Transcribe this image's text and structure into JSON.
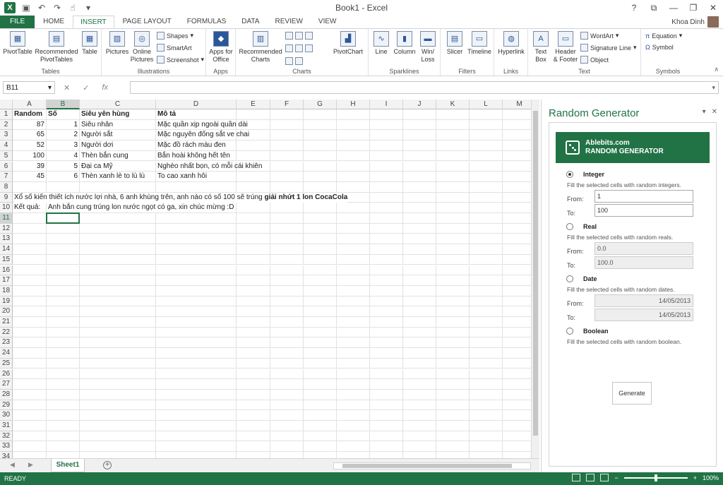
{
  "window": {
    "title": "Book1 - Excel",
    "user": "Khoa Dinh"
  },
  "tabs": [
    "FILE",
    "HOME",
    "INSERT",
    "PAGE LAYOUT",
    "FORMULAS",
    "DATA",
    "REVIEW",
    "VIEW"
  ],
  "active_tab": "INSERT",
  "ribbon": {
    "tables": {
      "label": "Tables",
      "pivottable": "PivotTable",
      "recommended": "Recommended PivotTables",
      "table": "Table"
    },
    "illustrations": {
      "label": "Illustrations",
      "pictures": "Pictures",
      "online": "Online Pictures",
      "shapes": "Shapes",
      "smartart": "SmartArt",
      "screenshot": "Screenshot"
    },
    "apps": {
      "label": "Apps",
      "apps_office": "Apps for Office"
    },
    "charts": {
      "label": "Charts",
      "recommended": "Recommended Charts",
      "pivotchart": "PivotChart"
    },
    "sparklines": {
      "label": "Sparklines",
      "line": "Line",
      "column": "Column",
      "winloss": "Win/ Loss"
    },
    "filters": {
      "label": "Filters",
      "slicer": "Slicer",
      "timeline": "Timeline"
    },
    "links": {
      "label": "Links",
      "hyperlink": "Hyperlink"
    },
    "text": {
      "label": "Text",
      "textbox": "Text Box",
      "headerfooter": "Header & Footer",
      "wordart": "WordArt",
      "signature": "Signature Line",
      "object": "Object"
    },
    "symbols": {
      "label": "Symbols",
      "equation": "Equation",
      "symbol": "Symbol"
    }
  },
  "formula_bar": {
    "name_box": "B11",
    "fx": "fx",
    "value": ""
  },
  "grid": {
    "columns": [
      "A",
      "B",
      "C",
      "D",
      "E",
      "F",
      "G",
      "H",
      "I",
      "J",
      "K",
      "L",
      "M"
    ],
    "selected_column": "B",
    "selected_row": "11",
    "row_numbers": [
      "1",
      "2",
      "3",
      "4",
      "5",
      "6",
      "7",
      "8",
      "9",
      "10",
      "11",
      "12",
      "13",
      "14",
      "15",
      "16",
      "17",
      "18",
      "19",
      "20",
      "21",
      "22",
      "23",
      "24",
      "25",
      "26",
      "27",
      "28",
      "29",
      "30",
      "31",
      "32",
      "33",
      "34"
    ],
    "header_row": [
      "Random",
      "Số",
      "Siêu yên hùng",
      "Mô tả"
    ],
    "data_rows": [
      [
        "87",
        "1",
        "Siêu nhân",
        "Mặc quần xịp ngoài quần dài"
      ],
      [
        "65",
        "2",
        "Người sắt",
        "Mặc nguyên đống sắt ve chai"
      ],
      [
        "52",
        "3",
        "Người dơi",
        "Mặc đồ rách màu đen"
      ],
      [
        "100",
        "4",
        "Thèn bắn cung",
        "Bắn hoài không hết tên"
      ],
      [
        "39",
        "5",
        "Đại ca Mỹ",
        "Nghèo nhất bọn, có mỗi cái khiên"
      ],
      [
        "45",
        "6",
        "Thèn xanh lè to lù lù",
        "To cao xanh hôi"
      ]
    ],
    "row9_text": "Xổ số kiến thiết ích nước lợi nhà, 6 anh khùng trên, anh nào có số 100 sẽ trúng ",
    "row9_bold": "giải nhứt 1 lon CocaCola",
    "row10_label": "Kết quả:",
    "row10_text": "Anh bắn cung trúng lon nước ngọt có ga, xin chúc mừng :D"
  },
  "sheet": {
    "name": "Sheet1"
  },
  "status": {
    "ready": "READY",
    "zoom": "100%"
  },
  "pane": {
    "title": "Random Generator",
    "brand_line1": "Ablebits.com",
    "brand_line2": "RANDOM GENERATOR",
    "integer": {
      "label": "Integer",
      "desc": "Fill the selected cells with random integers.",
      "from_label": "From:",
      "to_label": "To:",
      "from": "1",
      "to": "100",
      "selected": true
    },
    "real": {
      "label": "Real",
      "desc": "Fill the selected cells with random reals.",
      "from_label": "From:",
      "to_label": "To:",
      "from": "0.0",
      "to": "100.0"
    },
    "date": {
      "label": "Date",
      "desc": "Fill the selected cells with random dates.",
      "from_label": "From:",
      "to_label": "To:",
      "from": "14/05/2013",
      "to": "14/05/2013"
    },
    "boolean": {
      "label": "Boolean",
      "desc": "Fill the selected cells with random boolean."
    },
    "generate": "Generate"
  }
}
